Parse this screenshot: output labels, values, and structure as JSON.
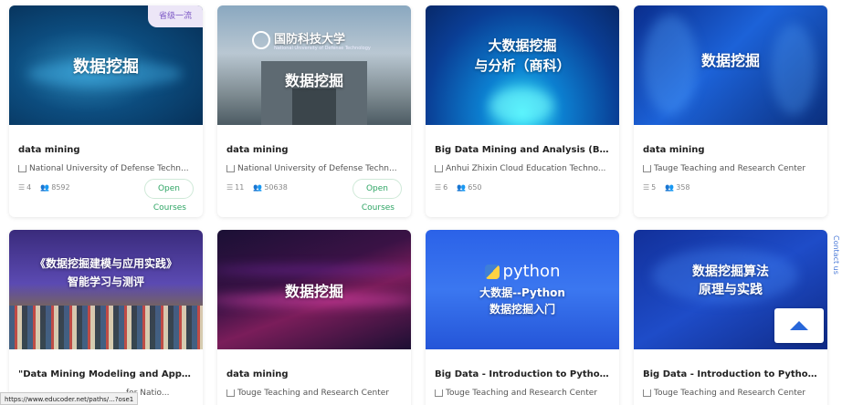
{
  "cards": [
    {
      "thumb_title": "数据挖掘",
      "corner_badge": "省级一流",
      "title": "data mining",
      "school": "National University of Defense Techn...",
      "chapters": "4",
      "learners": "8592",
      "badge": "Open",
      "badge_suffix": "Courses"
    },
    {
      "thumb_title": "数据挖掘",
      "univ_name": "国防科技大学",
      "univ_en": "National University of Defense Technology",
      "title": "data mining",
      "school": "National University of Defense Techn...",
      "chapters": "11",
      "learners": "50638",
      "badge": "Open",
      "badge_suffix": "Courses"
    },
    {
      "thumb_title": "大数据挖掘\n与分析（商科）",
      "title": "Big Data Mining and Analysis (Bu...",
      "school": "Anhui Zhixin Cloud Education Techno...",
      "chapters": "6",
      "learners": "650"
    },
    {
      "thumb_title": "数据挖掘",
      "title": "data mining",
      "school": "Tauge Teaching and Research Center",
      "chapters": "5",
      "learners": "358"
    },
    {
      "thumb_title": "《数据挖掘建模与应用实践》\n智能学习与测评",
      "title": "\"Data Mining Modeling and Appl...",
      "school": "for Natio..."
    },
    {
      "thumb_title": "数据挖掘",
      "title": "data mining",
      "school": "Touge Teaching and Research Center"
    },
    {
      "thumb_title": "大数据--Python\n数据挖掘入门",
      "python_word": "python",
      "title": "Big Data - Introduction to Python...",
      "school": "Touge Teaching and Research Center"
    },
    {
      "thumb_title": "数据挖掘算法\n原理与实践",
      "title": "Big Data - Introduction to Python...",
      "school": "Touge Teaching and Research Center"
    }
  ],
  "contact_label": "Contact us",
  "status_url": "https://www.educoder.net/paths/...?ose1",
  "icons": {
    "school": "building-icon",
    "chapters": "list-icon",
    "learners": "people-icon",
    "back_top": "arrow-up-icon"
  },
  "colors": {
    "open_badge": "#2fa565",
    "corner_badge_bg": "#ece6f7",
    "accent_blue": "#2867d9"
  }
}
